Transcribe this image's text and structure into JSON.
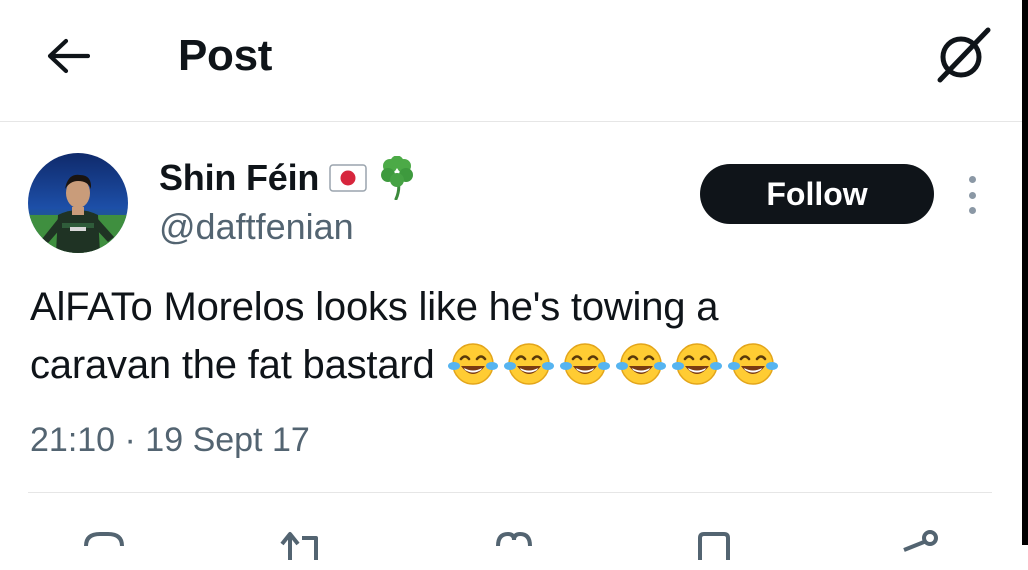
{
  "header": {
    "title": "Post",
    "back_icon": "arrow-left-icon",
    "grok_icon": "grok-icon"
  },
  "author": {
    "display_name": "Shin Féin",
    "name_emojis": [
      "japan-flag-emoji",
      "shamrock-emoji"
    ],
    "handle": "@daftfenian",
    "follow_label": "Follow"
  },
  "tweet": {
    "line1": "AlFATo Morelos looks like he's towing a",
    "line2": "caravan the fat bastard",
    "emoji": "face-with-tears-of-joy",
    "emoji_count": 6,
    "timestamp": "21:10 · 19 Sept 17"
  },
  "actions": [
    "reply-icon",
    "repost-icon",
    "like-icon",
    "bookmark-icon",
    "share-icon"
  ],
  "colors": {
    "text": "#0f1419",
    "secondary": "#536471",
    "follow_bg": "#0f1419",
    "follow_text": "#ffffff",
    "divider": "#e6e6e6"
  }
}
